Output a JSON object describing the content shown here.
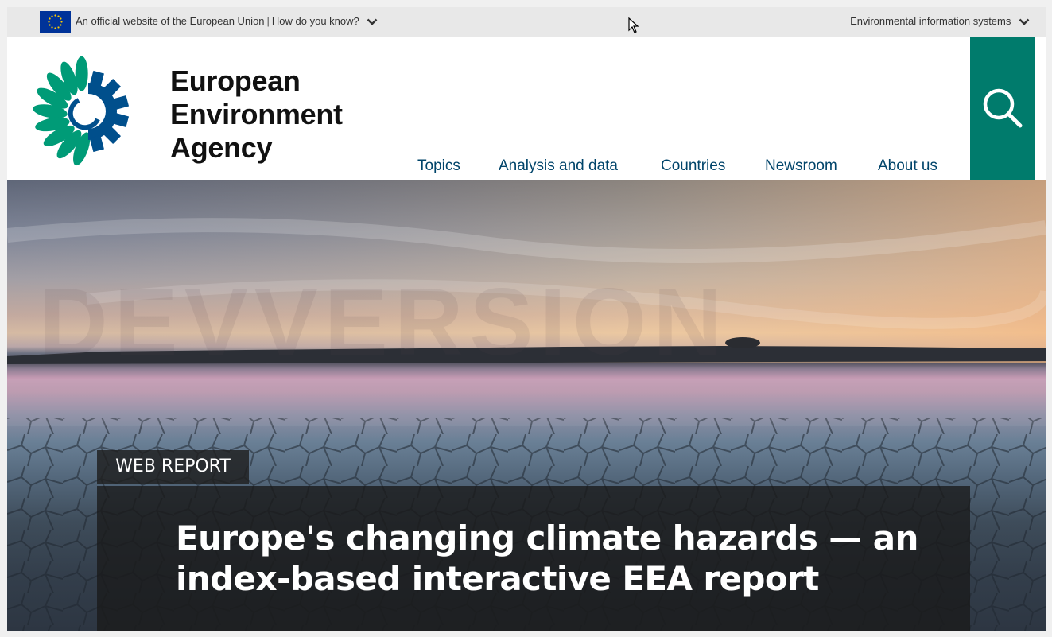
{
  "topbar": {
    "official_text": "An official website of the European Union",
    "how_text": "How do you know?",
    "env_systems": "Environmental information systems"
  },
  "header": {
    "brand_line1": "European",
    "brand_line2": "Environment",
    "brand_line3": "Agency",
    "nav": [
      {
        "label": "Topics"
      },
      {
        "label": "Analysis and data"
      },
      {
        "label": "Countries"
      },
      {
        "label": "Newsroom"
      },
      {
        "label": "About us"
      }
    ]
  },
  "hero": {
    "watermark": "DEVVERSION",
    "tag": "WEB REPORT",
    "title": "Europe's changing climate hazards — an index-based interactive EEA report"
  },
  "icons": {
    "eu_flag": "eu-flag-icon",
    "search": "search-icon",
    "chevron": "chevron-down-icon",
    "logo": "eea-logo-icon"
  },
  "colors": {
    "nav_text": "#00446a",
    "search_bg": "#007b6c",
    "logo_green": "#009b77",
    "logo_blue": "#004f8c"
  }
}
